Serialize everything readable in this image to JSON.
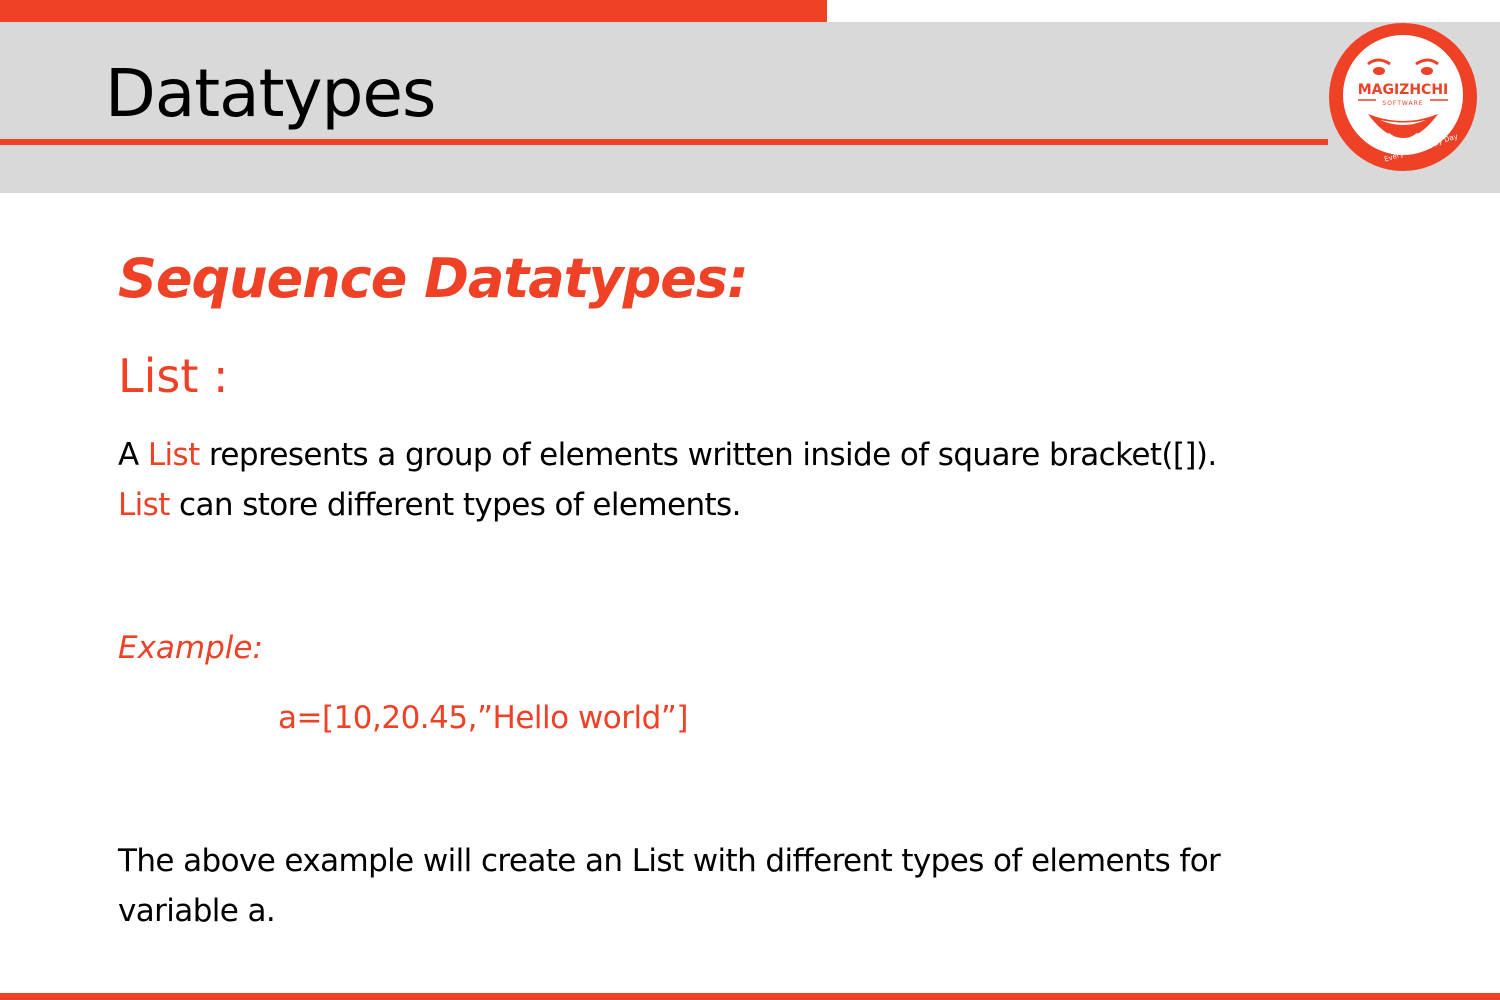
{
  "colors": {
    "accent": "#ee4125",
    "header_band": "#d9d9d9",
    "text": "#000000"
  },
  "header": {
    "title": "Datatypes"
  },
  "logo": {
    "name": "MAGIZHCHI",
    "sub": "SOFTWARE",
    "tagline": "Every Day Happy Day"
  },
  "content": {
    "section_heading": "Sequence Datatypes:",
    "subheading": "List :",
    "paragraph1": {
      "line1_prefix": "A ",
      "line1_term": "List",
      "line1_rest": " represents a group of elements written inside of square bracket([]).",
      "line2_term": "List",
      "line2_rest": " can store different types of elements."
    },
    "example_label": "Example:",
    "example_code": "a=[10,20.45,”Hello world”]",
    "paragraph2": {
      "line1": "The above example will create an List with different types of elements for",
      "line2": "variable a."
    }
  }
}
